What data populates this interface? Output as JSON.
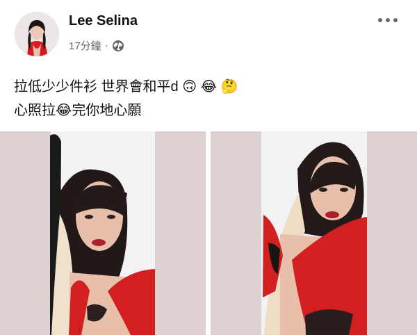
{
  "post": {
    "author": "Lee Selina",
    "time": "17分鐘",
    "separator": "·",
    "privacy_icon": "globe-icon",
    "more_icon": "more-horizontal-icon",
    "text_line1": "拉低少少件衫 世界會和平d",
    "line1_emojis": [
      "🙃",
      "😂",
      "🤔"
    ],
    "text_line2_a": "心照拉",
    "line2_emoji": "😂",
    "text_line2_b": "完你地心願"
  },
  "photos": [
    {
      "name": "photo-1"
    },
    {
      "name": "photo-2"
    }
  ],
  "colors": {
    "name": "#111111",
    "meta": "#65676b",
    "photo_bg": "#ddd0d1",
    "accent_red": "#d21f1f"
  }
}
